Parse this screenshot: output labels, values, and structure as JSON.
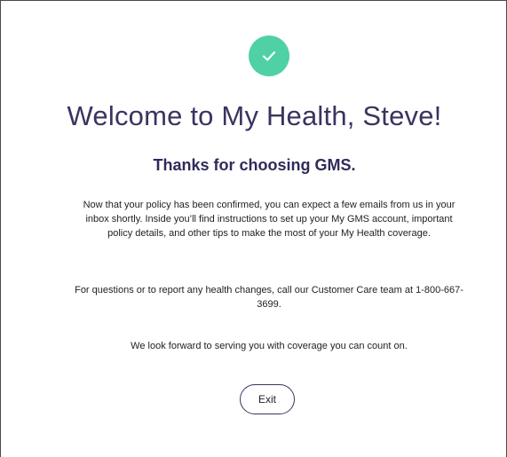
{
  "header": {
    "icon": "checkmark-icon",
    "icon_color": "#4fd1a5",
    "title": "Welcome to My Health, Steve!",
    "subtitle": "Thanks for choosing GMS."
  },
  "body": {
    "paragraph_1": "Now that your policy has been confirmed, you can expect a few emails from us in your inbox shortly. Inside you’ll find instructions to set up your My GMS account, important policy details, and other tips to make the most of your My Health coverage.",
    "paragraph_2": "For questions or to report any health changes, call our Customer Care team at 1-800-667-3699.",
    "paragraph_3": "We look forward to serving you with coverage you can count on."
  },
  "actions": {
    "exit_label": "Exit"
  },
  "colors": {
    "title": "#39345f",
    "subtitle": "#2f2b5a",
    "button_border": "#39345f"
  }
}
